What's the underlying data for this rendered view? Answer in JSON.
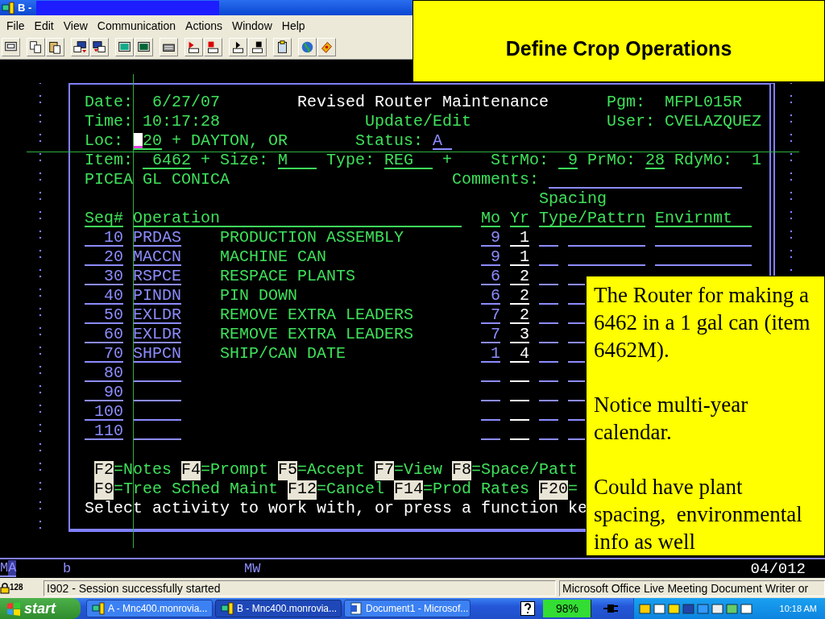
{
  "window": {
    "title": "B -"
  },
  "menu": [
    "File",
    "Edit",
    "View",
    "Communication",
    "Actions",
    "Window",
    "Help"
  ],
  "screen": {
    "date_label": "Date:",
    "date": "6/27/07",
    "title": "Revised Router Maintenance",
    "pgm_label": "Pgm:",
    "pgm": "MFPL015R",
    "time_label": "Time:",
    "time": "10:17:28",
    "mode": "Update/Edit",
    "user_label": "User:",
    "user": "CVELAZQUEZ",
    "loc_label": "Loc:",
    "loc": "20",
    "loc_name": "+ DAYTON, OR",
    "status_label": "Status:",
    "status": "A",
    "item_label": "Item:",
    "item": "6462",
    "size_label": "+ Size:",
    "size": "M",
    "type_label": "Type:",
    "type": "REG",
    "type_prompt": "+",
    "strmo_label": "StrMo:",
    "strmo": "9",
    "prmo_label": "PrMo:",
    "prmo": "28",
    "rdymo_label": "RdyMo:",
    "rdymo": "1",
    "description": "PICEA GL CONICA",
    "comments_label": "Comments:",
    "spacing_label": "Spacing"
  },
  "columns": [
    "Seq#",
    "Operation",
    "Mo",
    "Yr",
    "Type/Pattrn",
    "Envirnmt"
  ],
  "rows": [
    {
      "seq": "10",
      "code": "PRDAS",
      "operation": "PRODUCTION ASSEMBLY",
      "mo": "9",
      "yr": "1"
    },
    {
      "seq": "20",
      "code": "MACCN",
      "operation": "MACHINE CAN",
      "mo": "9",
      "yr": "1"
    },
    {
      "seq": "30",
      "code": "RSPCE",
      "operation": "RESPACE PLANTS",
      "mo": "6",
      "yr": "2"
    },
    {
      "seq": "40",
      "code": "PINDN",
      "operation": "PIN DOWN",
      "mo": "6",
      "yr": "2"
    },
    {
      "seq": "50",
      "code": "EXLDR",
      "operation": "REMOVE EXTRA LEADERS",
      "mo": "7",
      "yr": "2"
    },
    {
      "seq": "60",
      "code": "EXLDR",
      "operation": "REMOVE EXTRA LEADERS",
      "mo": "7",
      "yr": "3"
    },
    {
      "seq": "70",
      "code": "SHPCN",
      "operation": "SHIP/CAN DATE",
      "mo": "1",
      "yr": "4"
    },
    {
      "seq": "80"
    },
    {
      "seq": "90"
    },
    {
      "seq": "100"
    },
    {
      "seq": "110"
    }
  ],
  "function_keys": [
    [
      {
        "key": "F2",
        "label": "=Notes"
      },
      {
        "key": "F4",
        "label": "=Prompt"
      },
      {
        "key": "F5",
        "label": "=Accept"
      },
      {
        "key": "F7",
        "label": "=View"
      },
      {
        "key": "F8",
        "label": "=Space/Patt"
      }
    ],
    [
      {
        "key": "F9",
        "label": "=Tree Sched Maint"
      },
      {
        "key": "F12",
        "label": "=Cancel"
      },
      {
        "key": "F14",
        "label": "=Prod Rates"
      },
      {
        "key": "F20",
        "label": "="
      }
    ]
  ],
  "prompt": "Select activity to work with, or press a function ke",
  "status_line": {
    "indicator": "MA",
    "flag": "b",
    "mode": "MW",
    "position": "04/012"
  },
  "status_bar": {
    "badge": "128",
    "message": "I902 - Session successfully started",
    "printer": "Microsoft Office Live Meeting Document Writer or"
  },
  "taskbar": {
    "start": "start",
    "tasks": [
      {
        "label": "A - Mnc400.monrovia...",
        "selected": false
      },
      {
        "label": "B - Mnc400.monrovia...",
        "selected": true
      },
      {
        "label": "Document1 - Microsof...",
        "selected": false
      }
    ],
    "battery": {
      "reading": "98%",
      "level": 0.98
    },
    "clock": "10:18 AM"
  },
  "slide": {
    "title": "Define Crop Operations",
    "callout": [
      "The Router for making a 6462 in a 1 gal can (item 6462M).",
      "Notice multi-year calendar.",
      "Could have plant spacing,  environmental info as well"
    ]
  }
}
